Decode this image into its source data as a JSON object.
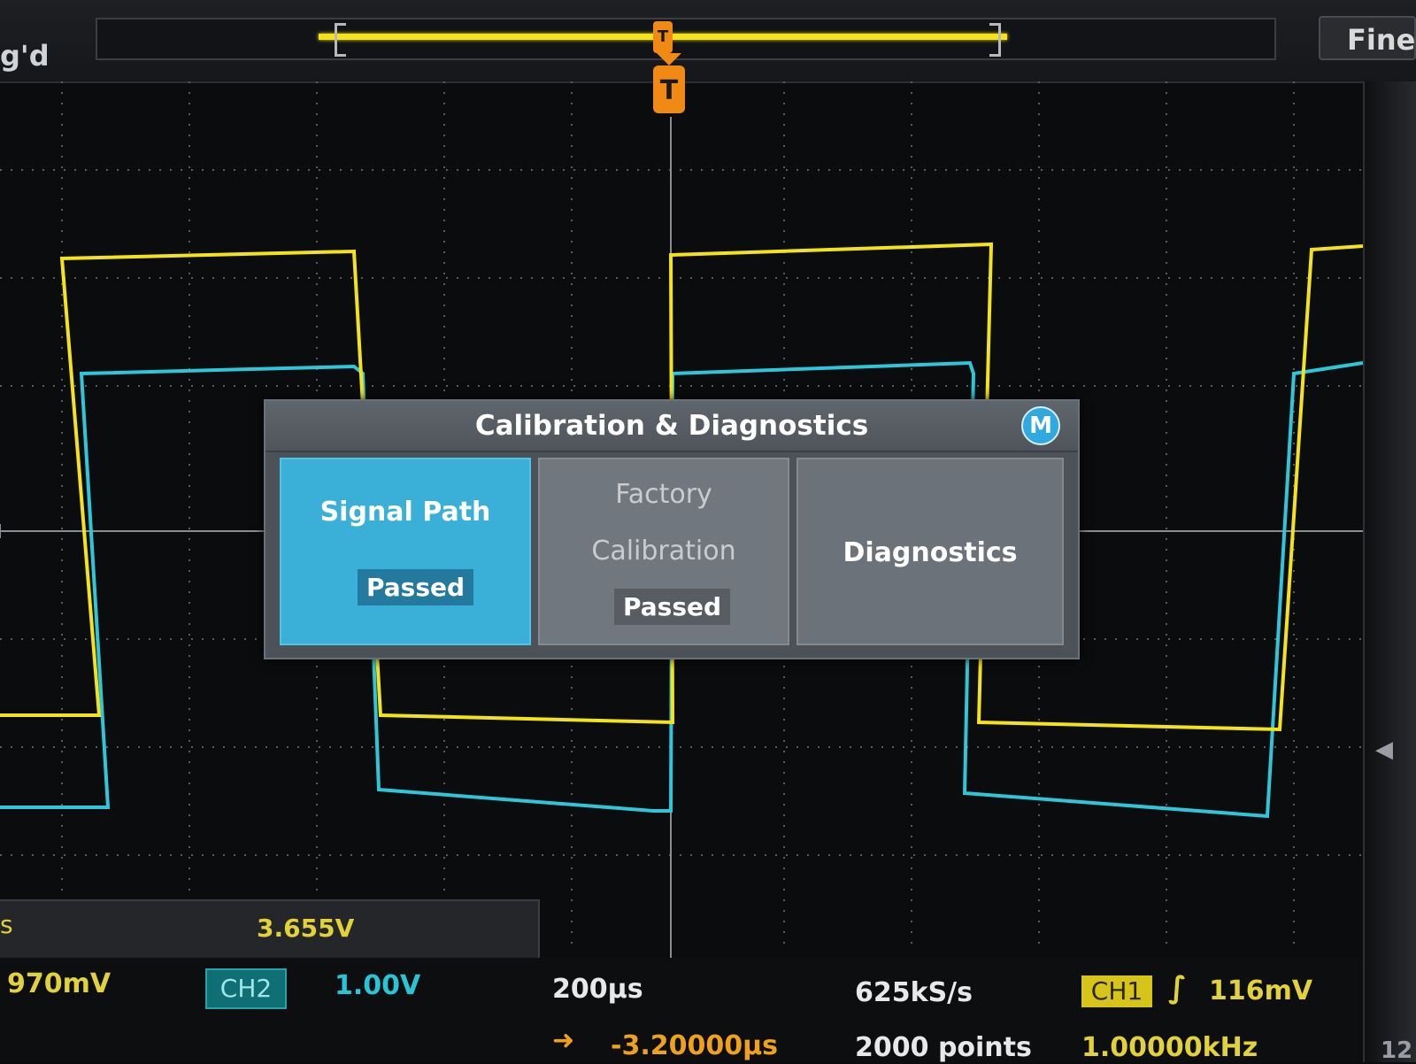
{
  "top_bar": {
    "trigger_status": "g'd",
    "fine_label": "Fine",
    "trigger_mini_label": "T"
  },
  "trigger_marker": {
    "label": "T",
    "color": "#f08a14"
  },
  "dialog": {
    "title": "Calibration & Diagnostics",
    "badge": "M",
    "tiles": {
      "signal_path": {
        "label": "Signal Path",
        "status": "Passed"
      },
      "factory_calibration": {
        "label_line1": "Factory",
        "label_line2": "Calibration",
        "status": "Passed"
      },
      "diagnostics": {
        "label": "Diagnostics"
      }
    }
  },
  "measurement": {
    "label": "s",
    "value": "3.655V"
  },
  "bottom_bar": {
    "ch1_scale": "970mV",
    "ch2_label": "CH2",
    "ch2_scale": "1.00V",
    "time_per_div": "200µs",
    "horizontal_position": "-3.20000µs",
    "sample_rate": "625kS/s",
    "record_length": "2000 points",
    "trigger_source": "CH1",
    "trigger_slope_icon": "rising-edge",
    "trigger_level": "116mV",
    "trigger_frequency": "1.00000kHz",
    "corner_digits": "12"
  },
  "colors": {
    "ch1": "#f4e21a",
    "ch2": "#2ec6d8",
    "dialog_accent": "#3aafd8",
    "trigger": "#f08a14"
  }
}
